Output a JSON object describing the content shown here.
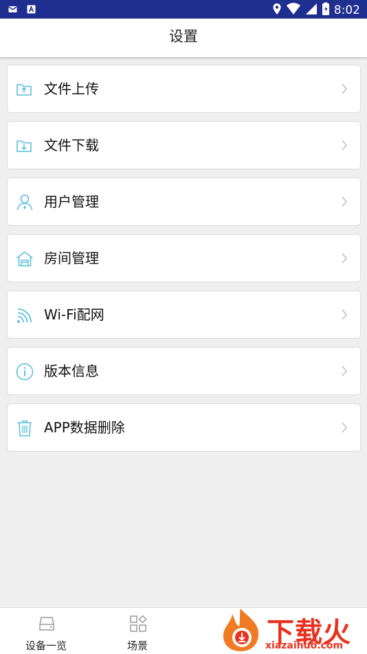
{
  "status_bar": {
    "time": "8:02"
  },
  "header": {
    "title": "设置"
  },
  "menu": {
    "items": [
      {
        "label": "文件上传",
        "icon": "folder-upload-icon"
      },
      {
        "label": "文件下载",
        "icon": "folder-download-icon"
      },
      {
        "label": "用户管理",
        "icon": "user-icon"
      },
      {
        "label": "房间管理",
        "icon": "house-icon"
      },
      {
        "label": "Wi-Fi配网",
        "icon": "wifi-icon"
      },
      {
        "label": "版本信息",
        "icon": "info-icon"
      },
      {
        "label": "APP数据删除",
        "icon": "trash-icon"
      }
    ]
  },
  "bottom_nav": {
    "tabs": [
      {
        "label": "设备一览",
        "icon": "device-icon"
      },
      {
        "label": "场景",
        "icon": "scene-grid-icon"
      }
    ]
  },
  "watermark": {
    "title": "下载火",
    "url": "xiazaihuo.com"
  },
  "colors": {
    "status_bar": "#1f2f8f",
    "icon_accent": "#5bc0de",
    "watermark": "#e8321f"
  }
}
